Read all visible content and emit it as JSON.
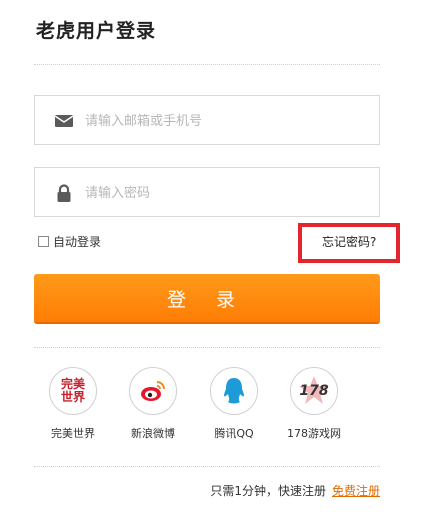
{
  "page": {
    "title": "老虎用户登录"
  },
  "form": {
    "account_placeholder": "请输入邮箱或手机号",
    "password_placeholder": "请输入密码",
    "remember_label": "自动登录",
    "forgot_label": "忘记密码?",
    "login_label": "登 录"
  },
  "social": [
    {
      "label": "完美世界",
      "logo_text": "完美世界",
      "icon": "perfect-world-icon",
      "color": "#c7202d"
    },
    {
      "label": "新浪微博",
      "icon": "weibo-icon",
      "color": "#e6162d"
    },
    {
      "label": "腾讯QQ",
      "icon": "qq-icon",
      "color": "#1d9bd7"
    },
    {
      "label": "178游戏网",
      "logo_text": "178",
      "icon": "178-icon",
      "color": "#333333"
    }
  ],
  "footer": {
    "text": "只需1分钟，快速注册",
    "link": "免费注册"
  },
  "colors": {
    "accent": "#ff8a0f",
    "highlight": "#e3262d",
    "link": "#e46a00"
  }
}
